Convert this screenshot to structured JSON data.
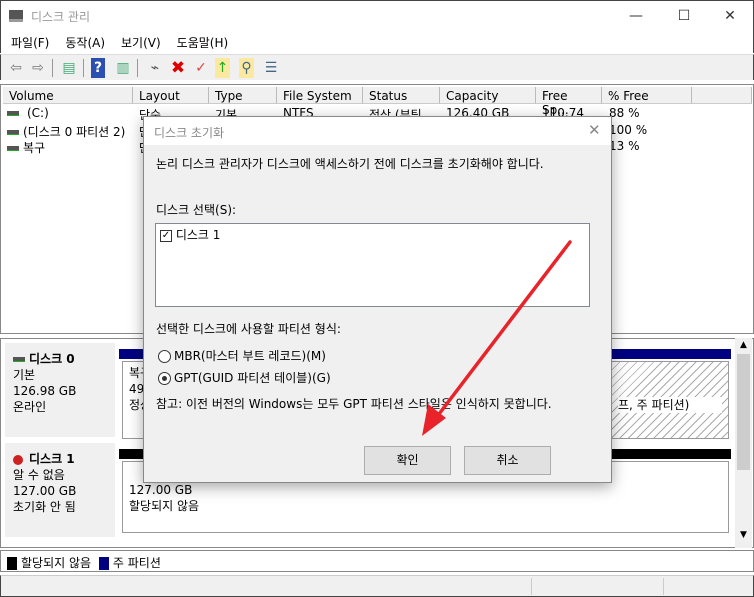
{
  "window": {
    "title": "디스크 관리",
    "minimize": "—",
    "maximize": "☐",
    "close": "✕"
  },
  "menu": [
    "파일(F)",
    "동작(A)",
    "보기(V)",
    "도움말(H)"
  ],
  "toolbar": [
    "back-icon",
    "forward-icon",
    "console-tree-icon",
    "help-icon",
    "action-pane-icon",
    "connect-drive-icon",
    "delete-icon",
    "properties-icon",
    "import-icon",
    "search-icon",
    "checklist-icon"
  ],
  "list": {
    "columns": [
      "Volume",
      "Layout",
      "Type",
      "File System",
      "Status",
      "Capacity",
      "Free Sp...",
      "% Free"
    ],
    "rows": [
      [
        "(C:)",
        "단순",
        "기본",
        "NTFS",
        "정상 (부팅",
        "126.40 GB",
        "110.74",
        "88 %"
      ],
      [
        "(디스크 0 파티션 2)",
        "단",
        "",
        "",
        "",
        "",
        "",
        "100 %"
      ],
      [
        "복구",
        "단",
        "",
        "",
        "",
        "",
        "",
        "13 %"
      ]
    ]
  },
  "disks": [
    {
      "name": "디스크 0",
      "type": "기본",
      "size": "126.98 GB",
      "state": "온라인",
      "vol_partial": [
        "복구",
        "499",
        "정상"
      ],
      "vol2_partial": "프, 주 파티션)"
    },
    {
      "name": "디스크 1",
      "type": "알 수 없음",
      "size": "127.00 GB",
      "state": "초기화 안 됨",
      "vol": [
        "127.00 GB",
        "할당되지 않음"
      ]
    }
  ],
  "legend": [
    {
      "label": "할당되지 않음",
      "color": "#000000"
    },
    {
      "label": "주 파티션",
      "color": "#000080"
    }
  ],
  "dialog": {
    "title": "디스크 초기화",
    "message": "논리 디스크 관리자가 디스크에 액세스하기 전에 디스크를 초기화해야 합니다.",
    "select_label": "디스크 선택(S):",
    "disk_item": "디스크 1",
    "disk_checked": true,
    "style_label": "선택한 디스크에 사용할 파티션 형식:",
    "mbr": "MBR(마스터 부트 레코드)(M)",
    "gpt": "GPT(GUID 파티션 테이블)(G)",
    "selected": "gpt",
    "note": "참고: 이전 버전의 Windows는 모두 GPT 파티션 스타일은 인식하지 못합니다.",
    "ok": "확인",
    "cancel": "취소"
  },
  "annotation_color": "#e8232a"
}
